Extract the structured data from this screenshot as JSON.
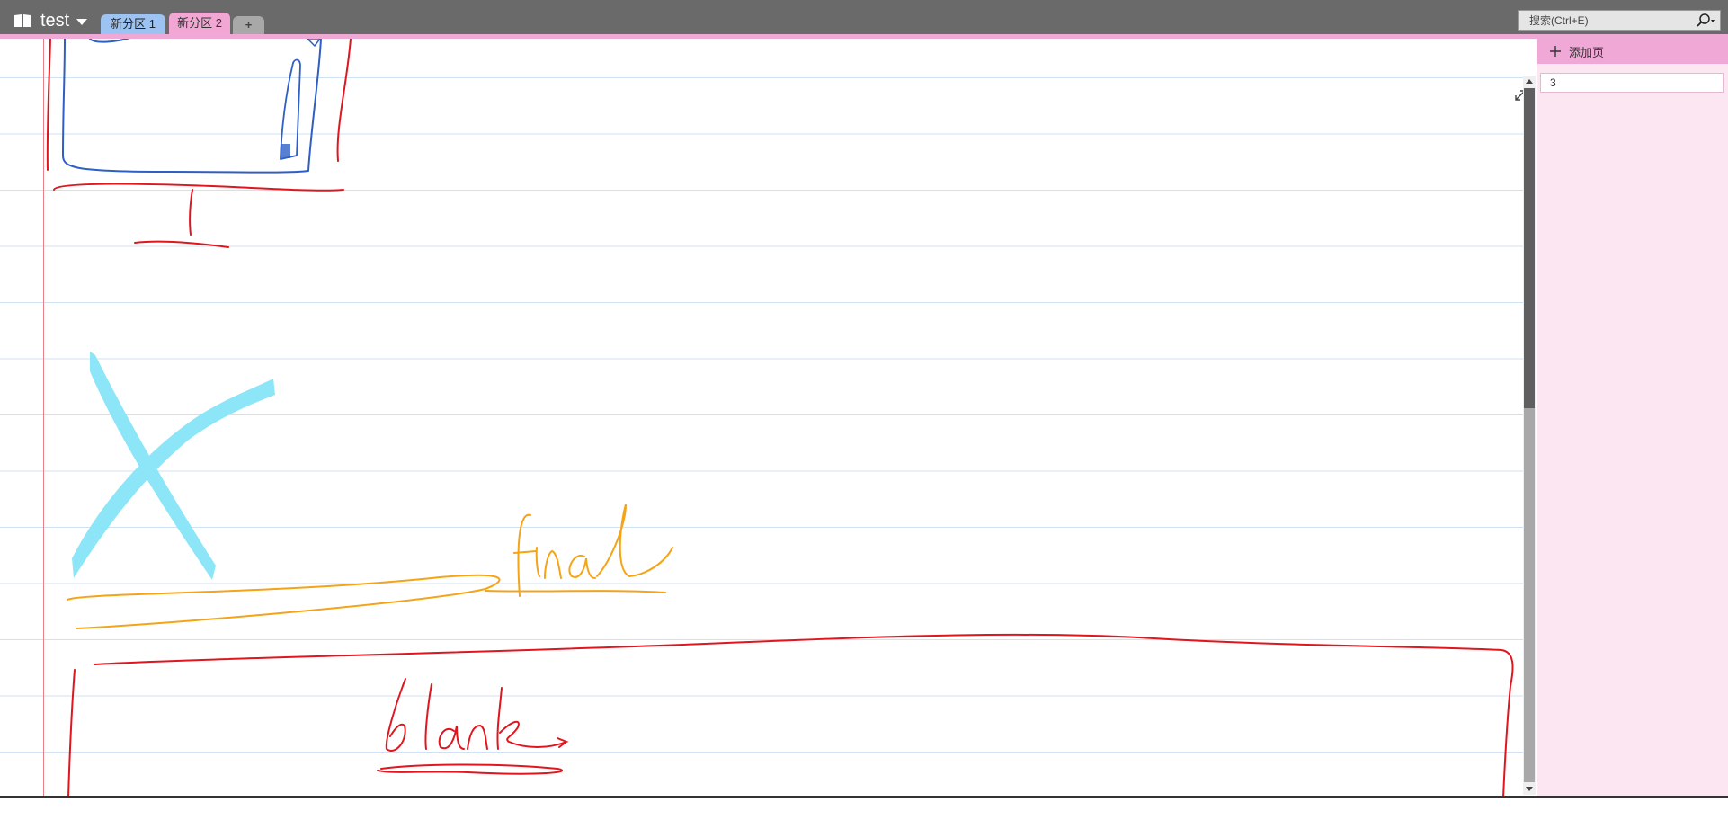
{
  "notebook": {
    "title": "test",
    "icon": "book-icon"
  },
  "sections": [
    {
      "label": "新分区 1",
      "color": "#9cc3f1"
    },
    {
      "label": "新分区 2",
      "color": "#f1a6d3",
      "selected": true
    }
  ],
  "add_section_label": "+",
  "search": {
    "placeholder": "搜索(Ctrl+E)",
    "value": ""
  },
  "page_pane": {
    "add_page_label": "添加页",
    "pages": [
      {
        "title": "3"
      }
    ]
  },
  "ink_words": [
    "final",
    "blank"
  ],
  "colors": {
    "topbar": "#6b6a6a",
    "accent_pink": "#f0a9d6",
    "page_pane_bg": "#fbe6f2",
    "ink_red": "#e0161f",
    "ink_blue": "#2f5fc4",
    "ink_cyan": "#8ce6f8",
    "ink_orange": "#f4a416"
  }
}
